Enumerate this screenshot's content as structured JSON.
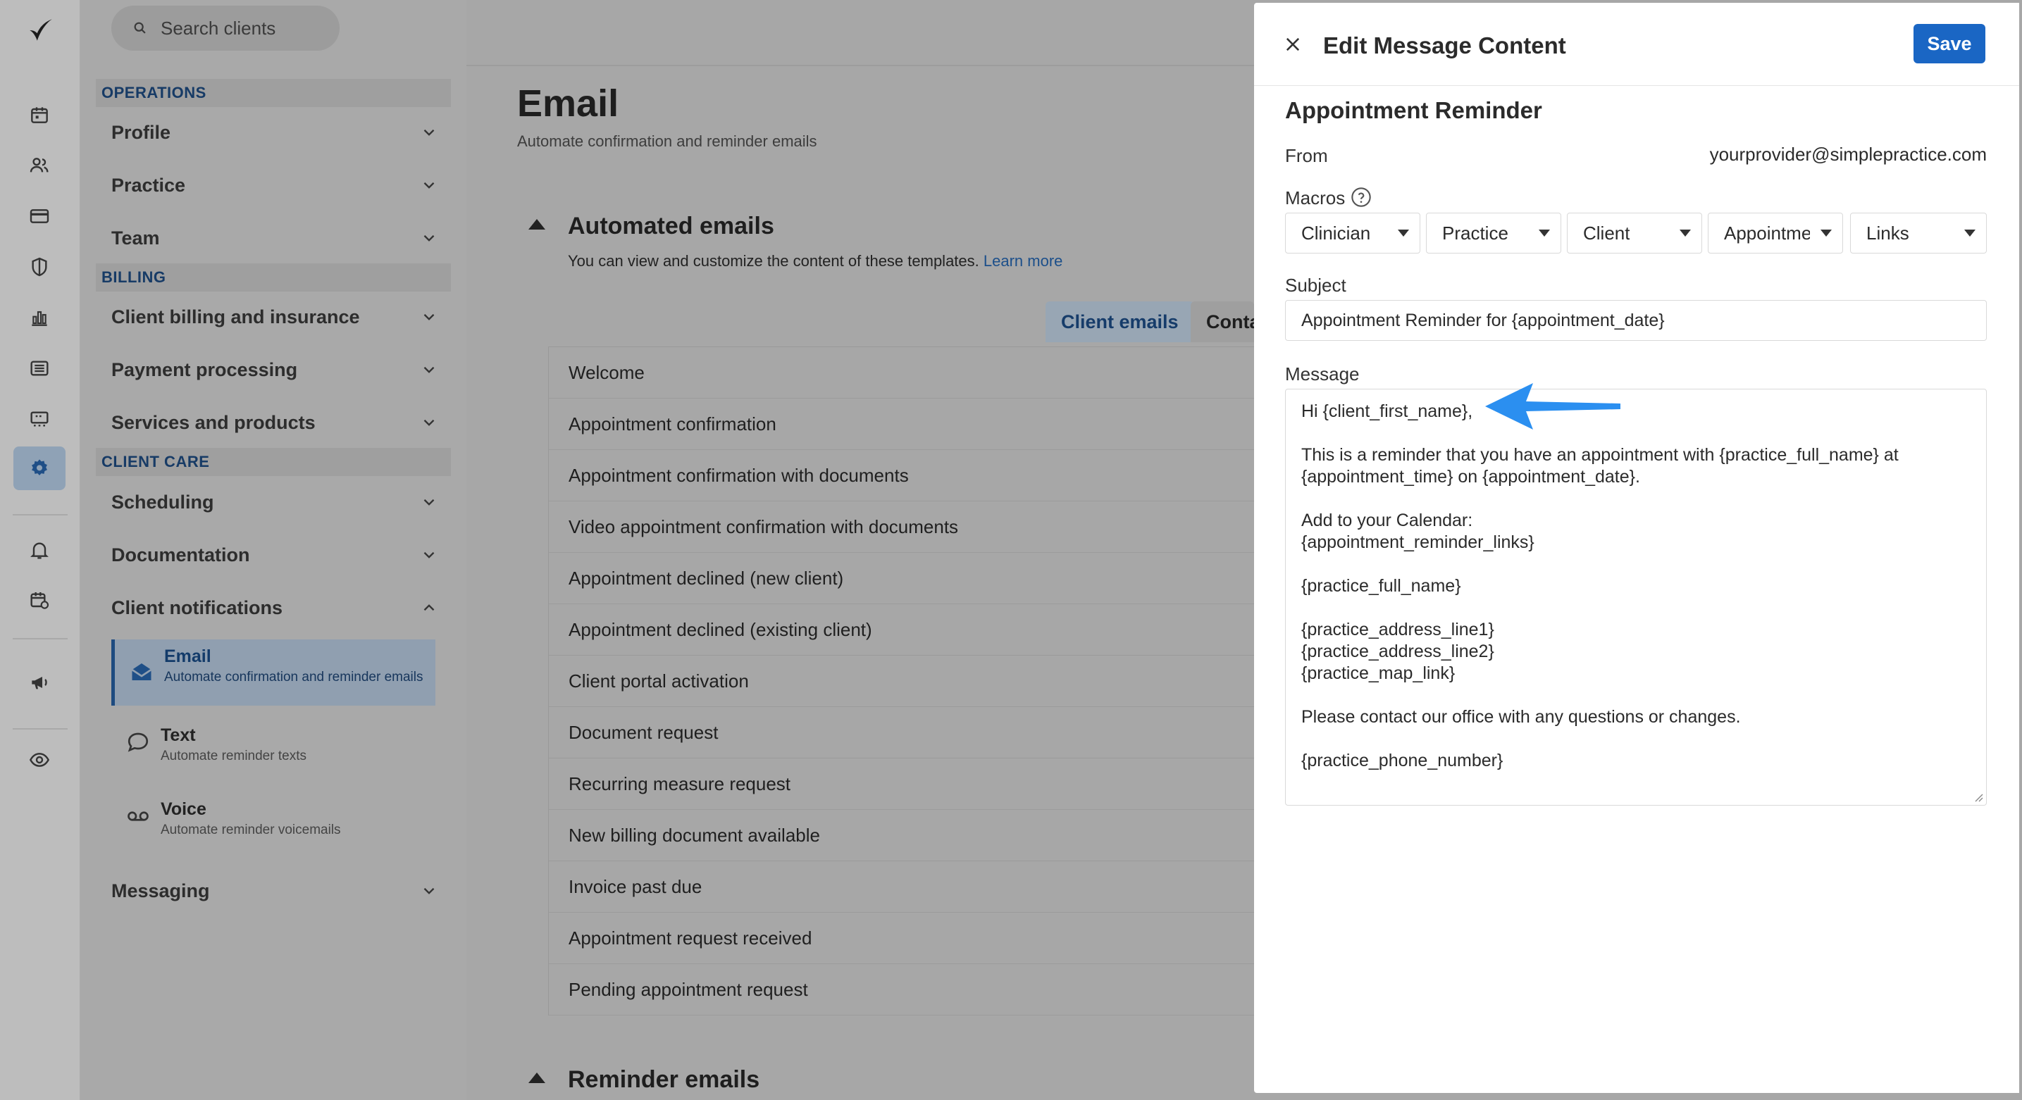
{
  "search": {
    "placeholder": "Search clients"
  },
  "nav": {
    "sections": {
      "operations": "OPERATIONS",
      "billing": "BILLING",
      "client_care": "CLIENT CARE"
    },
    "items": {
      "profile": "Profile",
      "practice": "Practice",
      "team": "Team",
      "client_billing": "Client billing and insurance",
      "payment_processing": "Payment processing",
      "services_products": "Services and products",
      "scheduling": "Scheduling",
      "documentation": "Documentation",
      "client_notifications": "Client notifications",
      "messaging": "Messaging"
    },
    "sub_items": [
      {
        "title": "Email",
        "desc": "Automate confirmation and reminder emails"
      },
      {
        "title": "Text",
        "desc": "Automate reminder texts"
      },
      {
        "title": "Voice",
        "desc": "Automate reminder voicemails"
      }
    ]
  },
  "main": {
    "title": "Email",
    "subtitle": "Automate confirmation and reminder emails",
    "automated": {
      "title": "Automated emails",
      "desc": "You can view and customize the content of these templates.",
      "learn_more": "Learn more"
    },
    "tabs": {
      "client": "Client emails",
      "other": "Conta"
    },
    "templates": [
      "Welcome",
      "Appointment confirmation",
      "Appointment confirmation with documents",
      "Video appointment confirmation with documents",
      "Appointment declined (new client)",
      "Appointment declined (existing client)",
      "Client portal activation",
      "Document request",
      "Recurring measure request",
      "New billing document available",
      "Invoice past due",
      "Appointment request received",
      "Pending appointment request"
    ],
    "reminder": {
      "title": "Reminder emails"
    }
  },
  "panel": {
    "title": "Edit Message Content",
    "save": "Save",
    "template_name": "Appointment Reminder",
    "from_label": "From",
    "from_value": "yourprovider@simplepractice.com",
    "macros_label": "Macros",
    "macros": [
      "Clinician",
      "Practice",
      "Client",
      "Appointmer",
      "Links"
    ],
    "subject_label": "Subject",
    "subject_value": "Appointment Reminder for {appointment_date}",
    "message_label": "Message",
    "message_lines": [
      "Hi {client_first_name},",
      "",
      "This is a reminder that you have an appointment with {practice_full_name} at",
      "{appointment_time} on {appointment_date}.",
      "",
      "Add to your Calendar:",
      "{appointment_reminder_links}",
      "",
      "{practice_full_name}",
      "",
      "{practice_address_line1}",
      "{practice_address_line2}",
      "{practice_map_link}",
      "",
      "Please contact our office with any questions or changes.",
      "",
      "{practice_phone_number}"
    ]
  },
  "colors": {
    "primary": "#1a66c4",
    "overlay": "#a7a7a7",
    "arrow": "#2b8ff0"
  }
}
